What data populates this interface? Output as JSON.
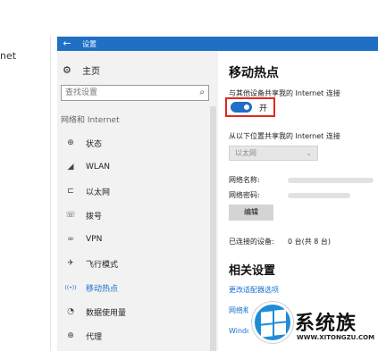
{
  "left_edge_text": "net",
  "window": {
    "title": "设置",
    "back_glyph": "←"
  },
  "sidebar": {
    "home_label": "主页",
    "search_placeholder": "查找设置",
    "section_label": "网络和 Internet",
    "items": [
      {
        "label": "状态",
        "icon": "globe-icon",
        "glyph": "⊕"
      },
      {
        "label": "WLAN",
        "icon": "wifi-icon",
        "glyph": "◢"
      },
      {
        "label": "以太网",
        "icon": "ethernet-icon",
        "glyph": "⊏"
      },
      {
        "label": "拨号",
        "icon": "dialup-icon",
        "glyph": "☏"
      },
      {
        "label": "VPN",
        "icon": "vpn-icon",
        "glyph": "∞"
      },
      {
        "label": "飞行模式",
        "icon": "airplane-icon",
        "glyph": "✈"
      },
      {
        "label": "移动热点",
        "icon": "hotspot-icon",
        "glyph": "((•))"
      },
      {
        "label": "数据使用量",
        "icon": "data-usage-icon",
        "glyph": "◔"
      },
      {
        "label": "代理",
        "icon": "proxy-icon",
        "glyph": "⊕"
      }
    ],
    "active_item": "移动热点"
  },
  "content": {
    "title": "移动热点",
    "share_label": "与其他设备共享我的 Internet 连接",
    "toggle_state": "开",
    "toggle_on": true,
    "share_from_label": "从以下位置共享我的 Internet 连接",
    "share_from_value": "以太网",
    "network_name_label": "网络名称:",
    "network_password_label": "网络密码:",
    "edit_button": "编辑",
    "connected_label": "已连接的设备:",
    "connected_value": "0 台(共 8 台)",
    "related_title": "相关设置",
    "related_links": [
      "更改适配器选项",
      "网络和共享中心",
      "Windows 防火墙"
    ]
  },
  "watermark": {
    "name": "系统族",
    "url": "WWW.XITONGZU.COM"
  },
  "colors": {
    "accent": "#1f6fc5",
    "highlight_box": "#e0281e"
  }
}
